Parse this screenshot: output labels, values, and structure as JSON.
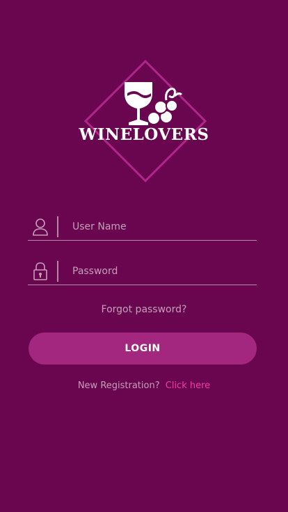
{
  "brand": {
    "name": "WINELOVERS"
  },
  "login_form": {
    "username_placeholder": "User Name",
    "password_placeholder": "Password",
    "forgot_password": "Forgot password?",
    "login_button": "LOGIN"
  },
  "registration": {
    "prompt": "New Registration?",
    "link": "Click here"
  },
  "icons": {
    "username": "user-icon",
    "password": "lock-icon",
    "logo": "wine-glass-grapes-logo"
  },
  "colors": {
    "background": "#6a0650",
    "button": "#a3267f",
    "link": "#f23ca9",
    "muted_text": "#c4a0b8",
    "logo_diamond": "#b0268a"
  }
}
